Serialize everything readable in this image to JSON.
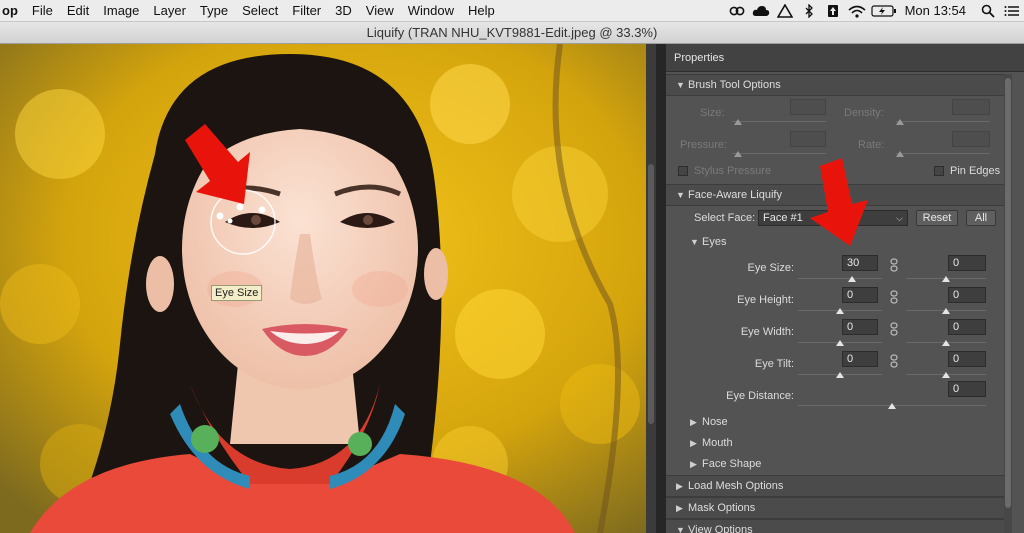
{
  "menubar": {
    "items": [
      "op",
      "File",
      "Edit",
      "Image",
      "Layer",
      "Type",
      "Select",
      "Filter",
      "3D",
      "View",
      "Window",
      "Help"
    ],
    "tray_icons": [
      "creative-cloud-icon",
      "cloud-icon",
      "drive-icon",
      "bluetooth-icon",
      "share-icon",
      "wifi-icon",
      "battery-icon"
    ],
    "clock": "Mon 13:54",
    "search_icon": "search-icon",
    "list_icon": "list-icon"
  },
  "window": {
    "title": "Liquify (TRAN NHU_KVT9881-Edit.jpeg @ 33.3%)"
  },
  "canvas": {
    "tooltip": "Eye Size"
  },
  "panel": {
    "title": "Properties",
    "brush": {
      "header": "Brush Tool Options",
      "size_label": "Size:",
      "density_label": "Density:",
      "pressure_label": "Pressure:",
      "rate_label": "Rate:",
      "stylus_label": "Stylus Pressure",
      "pin_edges_label": "Pin Edges"
    },
    "face": {
      "header": "Face-Aware Liquify",
      "select_face_label": "Select Face:",
      "select_face_value": "Face #1",
      "reset_label": "Reset",
      "all_label": "All",
      "eyes_header": "Eyes",
      "eye_size_label": "Eye Size:",
      "eye_size_left": "30",
      "eye_size_right": "0",
      "eye_height_label": "Eye Height:",
      "eye_height_left": "0",
      "eye_height_right": "0",
      "eye_width_label": "Eye Width:",
      "eye_width_left": "0",
      "eye_width_right": "0",
      "eye_tilt_label": "Eye Tilt:",
      "eye_tilt_left": "0",
      "eye_tilt_right": "0",
      "eye_distance_label": "Eye Distance:",
      "eye_distance_value": "0",
      "nose_label": "Nose",
      "mouth_label": "Mouth",
      "face_shape_label": "Face Shape"
    },
    "load_mesh_header": "Load Mesh Options",
    "mask_header": "Mask Options",
    "view_header": "View Options"
  },
  "colors": {
    "annotation_arrow": "#e8140c",
    "panel_bg": "#535353"
  }
}
